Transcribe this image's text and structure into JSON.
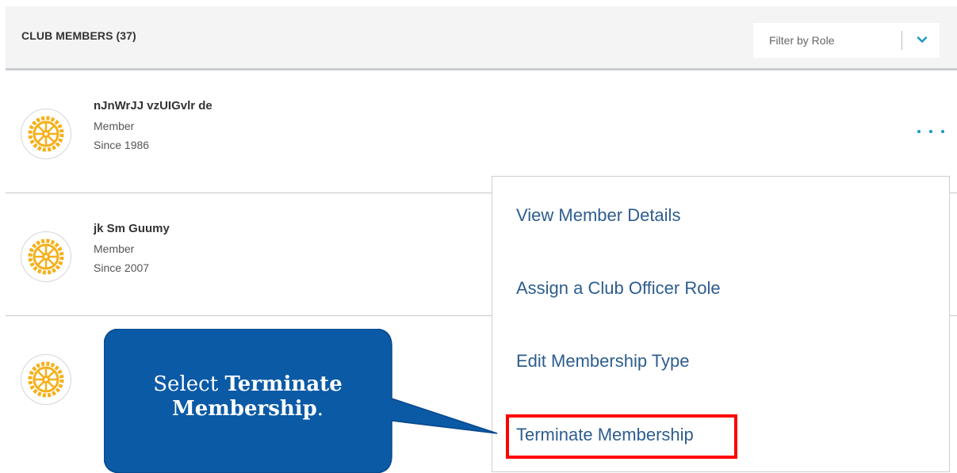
{
  "header": {
    "title": "CLUB MEMBERS (37)",
    "filter_placeholder": "Filter by Role"
  },
  "members": [
    {
      "name": "nJnWrJJ vzUIGvlr de",
      "role": "Member",
      "since": "Since 1986"
    },
    {
      "name": "jk Sm Guumy",
      "role": "Member",
      "since": "Since 2007"
    },
    {
      "name": "",
      "role": "",
      "since": ""
    }
  ],
  "action_menu": {
    "items": [
      "View Member Details",
      "Assign a Club Officer Role",
      "Edit Membership Type",
      "Terminate Membership"
    ]
  },
  "callout": {
    "prefix": "Select ",
    "bold": "Terminate Membership",
    "suffix": "."
  },
  "colors": {
    "accent": "#1797c2",
    "menu_text": "#2d5d8f",
    "callout_fill": "#0a5aa6",
    "highlight": "#ff0000",
    "emblem": "#f5b01a"
  },
  "icons": {
    "avatar": "rotary-wheel-icon",
    "filter": "chevron-down-icon",
    "more": "more-horizontal-icon"
  }
}
